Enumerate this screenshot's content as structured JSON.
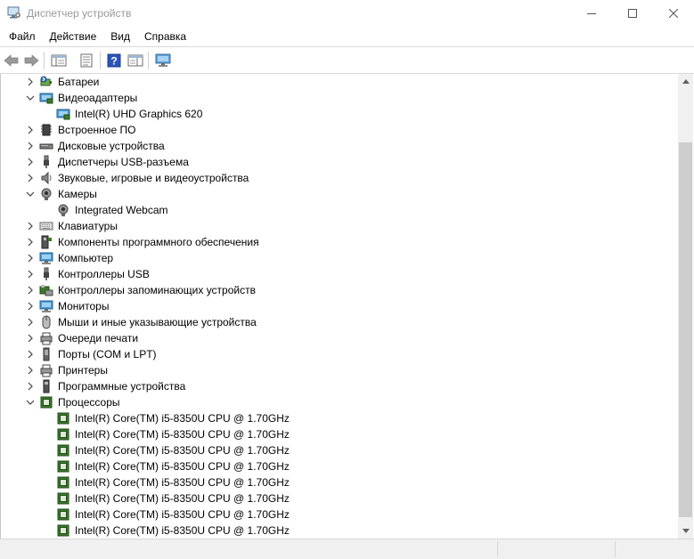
{
  "window": {
    "title": "Диспетчер устройств",
    "icon": "device-manager-icon"
  },
  "menu": [
    "Файл",
    "Действие",
    "Вид",
    "Справка"
  ],
  "toolbar": {
    "icons": [
      "back-arrow-icon",
      "forward-arrow-icon",
      "show-hide-console-tree-icon",
      "properties-icon",
      "help-icon",
      "action-pane-icon",
      "monitor-computer-icon"
    ]
  },
  "tree": [
    {
      "label": "Батареи",
      "level": 0,
      "state": "collapsed",
      "icon": "battery-icon"
    },
    {
      "label": "Видеоадаптеры",
      "level": 0,
      "state": "expanded",
      "icon": "display-adapter-icon"
    },
    {
      "label": "Intel(R) UHD Graphics 620",
      "level": 1,
      "state": "leaf",
      "icon": "display-adapter-icon"
    },
    {
      "label": "Встроенное ПО",
      "level": 0,
      "state": "collapsed",
      "icon": "firmware-chip-icon"
    },
    {
      "label": "Дисковые устройства",
      "level": 0,
      "state": "collapsed",
      "icon": "disk-drive-icon"
    },
    {
      "label": "Диспетчеры USB-разъема",
      "level": 0,
      "state": "collapsed",
      "icon": "usb-connector-icon"
    },
    {
      "label": "Звуковые, игровые и видеоустройства",
      "level": 0,
      "state": "collapsed",
      "icon": "speaker-icon"
    },
    {
      "label": "Камеры",
      "level": 0,
      "state": "expanded",
      "icon": "webcam-icon"
    },
    {
      "label": "Integrated Webcam",
      "level": 1,
      "state": "leaf",
      "icon": "webcam-icon"
    },
    {
      "label": "Клавиатуры",
      "level": 0,
      "state": "collapsed",
      "icon": "keyboard-icon"
    },
    {
      "label": "Компоненты программного обеспечения",
      "level": 0,
      "state": "collapsed",
      "icon": "software-component-icon"
    },
    {
      "label": "Компьютер",
      "level": 0,
      "state": "collapsed",
      "icon": "computer-icon"
    },
    {
      "label": "Контроллеры USB",
      "level": 0,
      "state": "collapsed",
      "icon": "usb-icon"
    },
    {
      "label": "Контроллеры запоминающих устройств",
      "level": 0,
      "state": "collapsed",
      "icon": "storage-controller-icon"
    },
    {
      "label": "Мониторы",
      "level": 0,
      "state": "collapsed",
      "icon": "monitor-icon"
    },
    {
      "label": "Мыши и иные указывающие устройства",
      "level": 0,
      "state": "collapsed",
      "icon": "mouse-icon"
    },
    {
      "label": "Очереди печати",
      "level": 0,
      "state": "collapsed",
      "icon": "print-queue-icon"
    },
    {
      "label": "Порты (COM и LPT)",
      "level": 0,
      "state": "collapsed",
      "icon": "port-icon"
    },
    {
      "label": "Принтеры",
      "level": 0,
      "state": "collapsed",
      "icon": "printer-icon"
    },
    {
      "label": "Программные устройства",
      "level": 0,
      "state": "collapsed",
      "icon": "software-device-icon"
    },
    {
      "label": "Процессоры",
      "level": 0,
      "state": "expanded",
      "icon": "processor-icon"
    },
    {
      "label": "Intel(R) Core(TM) i5-8350U CPU @ 1.70GHz",
      "level": 1,
      "state": "leaf",
      "icon": "processor-icon"
    },
    {
      "label": "Intel(R) Core(TM) i5-8350U CPU @ 1.70GHz",
      "level": 1,
      "state": "leaf",
      "icon": "processor-icon"
    },
    {
      "label": "Intel(R) Core(TM) i5-8350U CPU @ 1.70GHz",
      "level": 1,
      "state": "leaf",
      "icon": "processor-icon"
    },
    {
      "label": "Intel(R) Core(TM) i5-8350U CPU @ 1.70GHz",
      "level": 1,
      "state": "leaf",
      "icon": "processor-icon"
    },
    {
      "label": "Intel(R) Core(TM) i5-8350U CPU @ 1.70GHz",
      "level": 1,
      "state": "leaf",
      "icon": "processor-icon"
    },
    {
      "label": "Intel(R) Core(TM) i5-8350U CPU @ 1.70GHz",
      "level": 1,
      "state": "leaf",
      "icon": "processor-icon"
    },
    {
      "label": "Intel(R) Core(TM) i5-8350U CPU @ 1.70GHz",
      "level": 1,
      "state": "leaf",
      "icon": "processor-icon"
    },
    {
      "label": "Intel(R) Core(TM) i5-8350U CPU @ 1.70GHz",
      "level": 1,
      "state": "leaf",
      "icon": "processor-icon"
    }
  ],
  "colors": {
    "accent_blue": "#0078d7",
    "cpu_green": "#3c7a2a",
    "scroll_thumb": "#cdcdcd"
  }
}
